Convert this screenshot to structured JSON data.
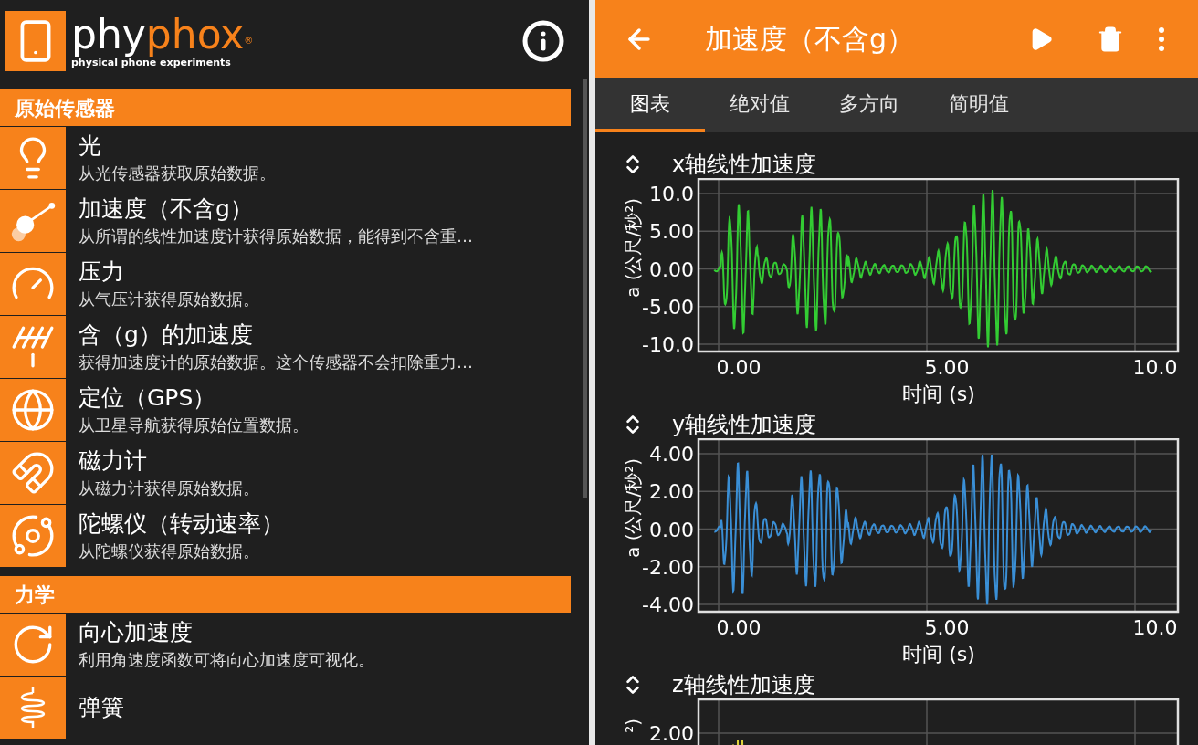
{
  "experiment_list": {
    "logo": {
      "wordmark_white": "phy",
      "wordmark_orange": "phox",
      "registered_mark": "®",
      "tagline": "physical phone experiments"
    },
    "categories": [
      {
        "title": "原始传感器",
        "items": [
          {
            "title": "光",
            "description": "从光传感器获取原始数据。"
          },
          {
            "title": "加速度（不含g）",
            "description": "从所谓的线性加速度计获得原始数据，能得到不含重…"
          },
          {
            "title": "压力",
            "description": "从气压计获得原始数据。"
          },
          {
            "title": "含（g）的加速度",
            "description": "获得加速度计的原始数据。这个传感器不会扣除重力…"
          },
          {
            "title": "定位（GPS）",
            "description": "从卫星导航获得原始位置数据。"
          },
          {
            "title": "磁力计",
            "description": "从磁力计获得原始数据。"
          },
          {
            "title": "陀螺仪（转动速率）",
            "description": "从陀螺仪获得原始数据。"
          }
        ]
      },
      {
        "title": "力学",
        "items": [
          {
            "title": "向心加速度",
            "description": "利用角速度函数可将向心加速度可视化。"
          },
          {
            "title": "弹簧"
          }
        ]
      }
    ]
  },
  "experiment": {
    "title": "加速度（不含g）",
    "tabs": [
      {
        "label": "图表",
        "selected": true
      },
      {
        "label": "绝对值",
        "selected": false
      },
      {
        "label": "多方向",
        "selected": false
      },
      {
        "label": "简明值",
        "selected": false
      }
    ],
    "charts": [
      {
        "title": "x轴线性加速度",
        "color": "#33cc33",
        "ylabel": "a (公尺/秒²)",
        "yticks": [
          "10.0",
          "5.00",
          "0.00",
          "-5.00",
          "-10.0"
        ],
        "xticks": [
          "0.00",
          "5.00",
          "10.0"
        ],
        "xlabel": "时间 (s)"
      },
      {
        "title": "y轴线性加速度",
        "color": "#3a8fd6",
        "ylabel": "a (公尺/秒²)",
        "yticks": [
          "4.00",
          "2.00",
          "0.00",
          "-2.00",
          "-4.00"
        ],
        "xticks": [
          "0.00",
          "5.00",
          "10.0"
        ],
        "xlabel": "时间 (s)"
      },
      {
        "title": "z轴线性加速度",
        "color": "#e0d23a",
        "ylabel": "²)",
        "yticks": [
          "2.00"
        ]
      }
    ]
  }
}
